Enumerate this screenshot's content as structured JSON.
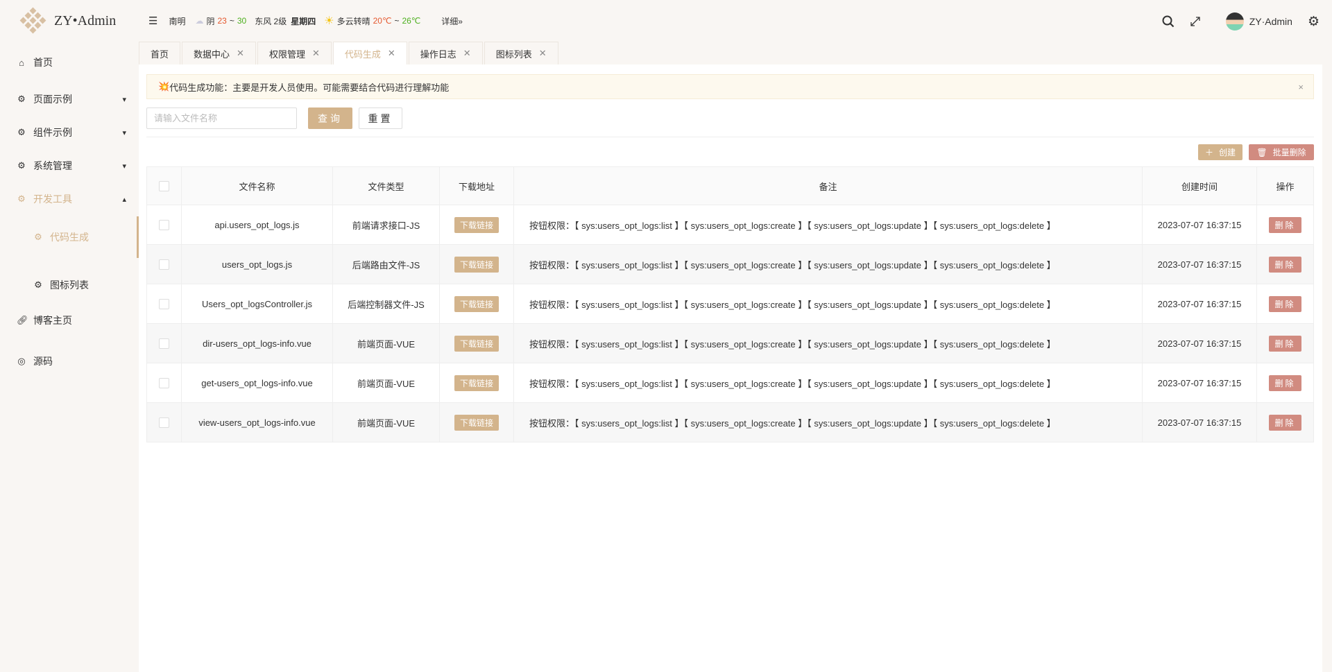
{
  "header": {
    "logo_text": "ZY•Admin",
    "city": "南明",
    "weather1": "阴",
    "temp1_low": "23",
    "temp_sep": "~",
    "temp1_high": "30",
    "wind": "东风 2级",
    "weekday": "星期四",
    "weather2": "多云转晴",
    "temp2_low": "20℃",
    "temp2_high": "26℃",
    "detail": "详细»",
    "username": "ZY·Admin"
  },
  "sidebar": {
    "items": [
      {
        "label": "首页"
      },
      {
        "label": "页面示例"
      },
      {
        "label": "组件示例"
      },
      {
        "label": "系统管理"
      },
      {
        "label": "开发工具"
      },
      {
        "label": "代码生成"
      },
      {
        "label": "图标列表"
      },
      {
        "label": "博客主页"
      },
      {
        "label": "源码"
      }
    ]
  },
  "tabs": [
    {
      "label": "首页"
    },
    {
      "label": "数据中心"
    },
    {
      "label": "权限管理"
    },
    {
      "label": "代码生成"
    },
    {
      "label": "操作日志"
    },
    {
      "label": "图标列表"
    }
  ],
  "alert": {
    "icon": "💥",
    "text": "代码生成功能：主要是开发人员使用。可能需要结合代码进行理解功能",
    "close": "×"
  },
  "search": {
    "placeholder": "请输入文件名称",
    "value": ""
  },
  "buttons": {
    "query": "查询",
    "reset": "重置",
    "create": "创建",
    "batch_delete": "批量删除"
  },
  "colors": {
    "accent": "#d3b48c",
    "danger": "#d18b80"
  },
  "table": {
    "columns": [
      "文件名称",
      "文件类型",
      "下载地址",
      "备注",
      "创建时间",
      "操作"
    ],
    "download_label": "下载链接",
    "delete_label": "删除",
    "rows": [
      {
        "name": "api.users_opt_logs.js",
        "type": "前端请求接口-JS",
        "note": "按钮权限：【 sys:users_opt_logs:list 】【 sys:users_opt_logs:create 】【 sys:users_opt_logs:update 】【 sys:users_opt_logs:delete 】",
        "time": "2023-07-07 16:37:15"
      },
      {
        "name": "users_opt_logs.js",
        "type": "后端路由文件-JS",
        "note": "按钮权限：【 sys:users_opt_logs:list 】【 sys:users_opt_logs:create 】【 sys:users_opt_logs:update 】【 sys:users_opt_logs:delete 】",
        "time": "2023-07-07 16:37:15"
      },
      {
        "name": "Users_opt_logsController.js",
        "type": "后端控制器文件-JS",
        "note": "按钮权限：【 sys:users_opt_logs:list 】【 sys:users_opt_logs:create 】【 sys:users_opt_logs:update 】【 sys:users_opt_logs:delete 】",
        "time": "2023-07-07 16:37:15"
      },
      {
        "name": "dir-users_opt_logs-info.vue",
        "type": "前端页面-VUE",
        "note": "按钮权限：【 sys:users_opt_logs:list 】【 sys:users_opt_logs:create 】【 sys:users_opt_logs:update 】【 sys:users_opt_logs:delete 】",
        "time": "2023-07-07 16:37:15"
      },
      {
        "name": "get-users_opt_logs-info.vue",
        "type": "前端页面-VUE",
        "note": "按钮权限：【 sys:users_opt_logs:list 】【 sys:users_opt_logs:create 】【 sys:users_opt_logs:update 】【 sys:users_opt_logs:delete 】",
        "time": "2023-07-07 16:37:15"
      },
      {
        "name": "view-users_opt_logs-info.vue",
        "type": "前端页面-VUE",
        "note": "按钮权限：【 sys:users_opt_logs:list 】【 sys:users_opt_logs:create 】【 sys:users_opt_logs:update 】【 sys:users_opt_logs:delete 】",
        "time": "2023-07-07 16:37:15"
      }
    ]
  }
}
